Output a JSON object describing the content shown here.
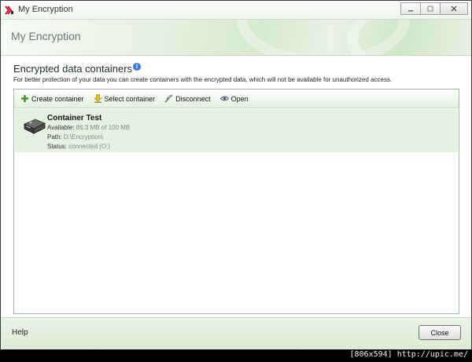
{
  "window": {
    "title": "My Encryption",
    "icon": "kaspersky-logo-icon",
    "controls": [
      "minimize",
      "maximize",
      "close"
    ]
  },
  "banner": {
    "title": "My Encryption"
  },
  "section": {
    "title": "Encrypted data containers",
    "description": "For better protection of your data you can create containers with the encrypted data, which will not be available for unauthorized access."
  },
  "toolbar": {
    "create": "Create container",
    "select": "Select container",
    "disconnect": "Disconnect",
    "open": "Open"
  },
  "containers": [
    {
      "name": "Container Test",
      "available_label": "Available:",
      "available_value": "86.3 MB of 100 MB",
      "path_label": "Path:",
      "path_value": "D:\\Encryption\\",
      "status_label": "Status:",
      "status_value": "connected (O:)"
    }
  ],
  "footer": {
    "help": "Help",
    "close": "Close"
  },
  "watermark": "[806x594] http://upic.me/",
  "colors": {
    "accent_green": "#e6f2e1",
    "toolbar_gradient_end": "#e3f0df",
    "info_blue": "#3a7ad8"
  }
}
